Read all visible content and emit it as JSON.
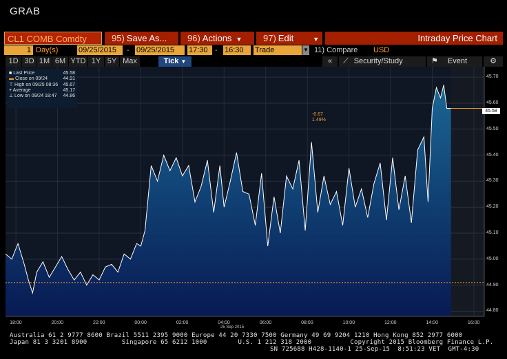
{
  "window_title": "GRAB",
  "toolbar": {
    "ticker": "CL1 COMB Comdty",
    "save": {
      "num": "95)",
      "label": "Save As..."
    },
    "actions": {
      "num": "96)",
      "label": "Actions"
    },
    "edit": {
      "num": "97)",
      "label": "Edit"
    },
    "chart_title": "Intraday Price Chart"
  },
  "params": {
    "period_value": "1",
    "period_unit": "Day(s)",
    "start_date": "09/25/2015",
    "end_date": "09/25/2015",
    "start_time": "17:30",
    "end_time": "16:30",
    "field": "Trade",
    "compare_label": "11) Compare",
    "currency": "USD"
  },
  "range_tabs": [
    "1D",
    "3D",
    "1M",
    "6M",
    "YTD",
    "1Y",
    "5Y",
    "Max"
  ],
  "range_selected": "Tick",
  "right_tools": {
    "arrow": "«",
    "security_study": "Security/Study",
    "event": "Event"
  },
  "legend": [
    {
      "label": "Last Price",
      "value": "45.58"
    },
    {
      "label": "Close on 09/24",
      "value": "44.91"
    },
    {
      "label": "High on 09/25 08:36",
      "value": "45.67"
    },
    {
      "label": "Average",
      "value": "45.17"
    },
    {
      "label": "Low on 09/24 18:47",
      "value": "44.86"
    }
  ],
  "last_price_tag": "45.58",
  "change_abs": "-0.67",
  "change_pct": "1.49%",
  "date_label": "25 Sep 2015",
  "colors": {
    "accent_orange": "#f0a030",
    "button_red": "#a31f00",
    "series_line": "#ffffff",
    "series_fill": "#1a5a8a",
    "background": "#000000"
  },
  "chart_data": {
    "type": "area",
    "x_ticks": [
      "18:00",
      "20:00",
      "22:00",
      "00:00",
      "02:00",
      "04:00",
      "06:00",
      "08:00",
      "10:00",
      "12:00",
      "14:00",
      "16:00"
    ],
    "y_ticks": [
      "45.70",
      "45.60",
      "45.50",
      "45.40",
      "45.30",
      "45.20",
      "45.10",
      "45.00",
      "44.90",
      "44.80"
    ],
    "ylim": [
      44.78,
      45.74
    ],
    "xlim_hours": [
      17.5,
      40.5
    ],
    "reference_line": 44.91,
    "series": [
      {
        "x": [
          17.5,
          17.8,
          18.1,
          18.4,
          18.6,
          18.8,
          19.0,
          19.3,
          19.6,
          19.9,
          20.2,
          20.5,
          20.8,
          21.1,
          21.4,
          21.7,
          22.0,
          22.3,
          22.6,
          22.9,
          23.2,
          23.5,
          23.8,
          24.0,
          24.2,
          24.5,
          24.8,
          25.1,
          25.4,
          25.7,
          26.0,
          26.3,
          26.6,
          26.9,
          27.2,
          27.5,
          27.8,
          28.0,
          28.3,
          28.6,
          28.9,
          29.2,
          29.5,
          29.8,
          30.1,
          30.4,
          30.7,
          31.0,
          31.3,
          31.6,
          31.9,
          32.2,
          32.5,
          32.8,
          33.1,
          33.4,
          33.7,
          34.0,
          34.3,
          34.6,
          34.9,
          35.2,
          35.5,
          35.8,
          36.1,
          36.4,
          36.7,
          37.0,
          37.3,
          37.6,
          37.8,
          38.0,
          38.2,
          38.4,
          38.55,
          38.7,
          38.8,
          38.9
        ],
        "y": [
          45.02,
          45.0,
          45.06,
          44.98,
          44.92,
          44.87,
          44.95,
          44.99,
          44.93,
          44.97,
          45.01,
          44.96,
          44.92,
          44.95,
          44.9,
          44.94,
          44.92,
          44.97,
          44.98,
          44.95,
          45.02,
          45.0,
          45.06,
          45.05,
          45.11,
          45.36,
          45.3,
          45.4,
          45.34,
          45.39,
          45.32,
          45.36,
          45.22,
          45.28,
          45.38,
          45.18,
          45.36,
          45.2,
          45.3,
          45.41,
          45.26,
          45.25,
          45.13,
          45.33,
          45.05,
          45.24,
          45.1,
          45.32,
          45.27,
          45.38,
          45.11,
          45.45,
          45.18,
          45.32,
          45.21,
          45.26,
          45.13,
          45.35,
          45.2,
          45.27,
          45.16,
          45.29,
          45.37,
          45.15,
          45.39,
          45.19,
          45.32,
          45.14,
          45.42,
          45.47,
          45.22,
          45.58,
          45.66,
          45.62,
          45.67,
          45.58,
          45.58,
          45.58
        ]
      }
    ]
  },
  "footer": {
    "line1": "Australia 61 2 9777 8600 Brazil 5511 2395 9000 Europe 44 20 7330 7500 Germany 49 69 9204 1210 Hong Kong 852 2977 6000",
    "line2": "Japan 81 3 3201 8900         Singapore 65 6212 1000        U.S. 1 212 318 2000          Copyright 2015 Bloomberg Finance L.P.",
    "line3": "SN 725688 H428-1140-1 25-Sep-15  8:51:23 VET  GMT-4:30"
  }
}
